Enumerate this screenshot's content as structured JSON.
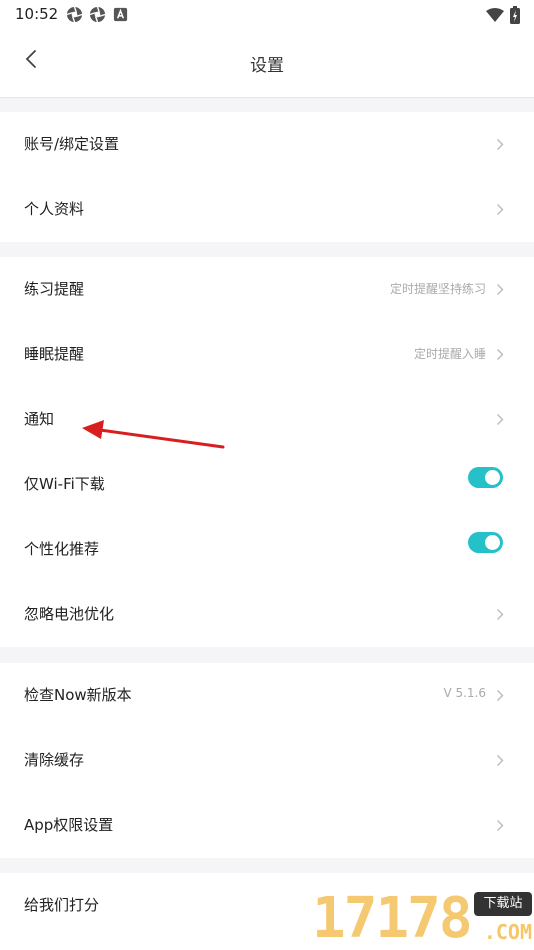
{
  "status_bar": {
    "time": "10:52"
  },
  "header": {
    "title": "设置"
  },
  "groups": [
    {
      "items": [
        {
          "label": "账号/绑定设置"
        },
        {
          "label": "个人资料"
        }
      ]
    },
    {
      "items": [
        {
          "label": "练习提醒",
          "value": "定时提醒坚持练习"
        },
        {
          "label": "睡眠提醒",
          "value": "定时提醒入睡"
        },
        {
          "label": "通知"
        },
        {
          "label": "仅Wi-Fi下载",
          "toggle": true
        },
        {
          "label": "个性化推荐",
          "toggle": true
        },
        {
          "label": "忽略电池优化"
        }
      ]
    },
    {
      "items": [
        {
          "label": "检查Now新版本",
          "value": "V 5.1.6"
        },
        {
          "label": "清除缓存"
        },
        {
          "label": "App权限设置"
        }
      ]
    },
    {
      "items": [
        {
          "label": "给我们打分"
        }
      ]
    }
  ],
  "watermark": {
    "digits": "17178",
    "badge": "下载站",
    "suffix": ".COM"
  },
  "colors": {
    "accent": "#26c0c8",
    "annotation_arrow": "#d81e1e"
  }
}
